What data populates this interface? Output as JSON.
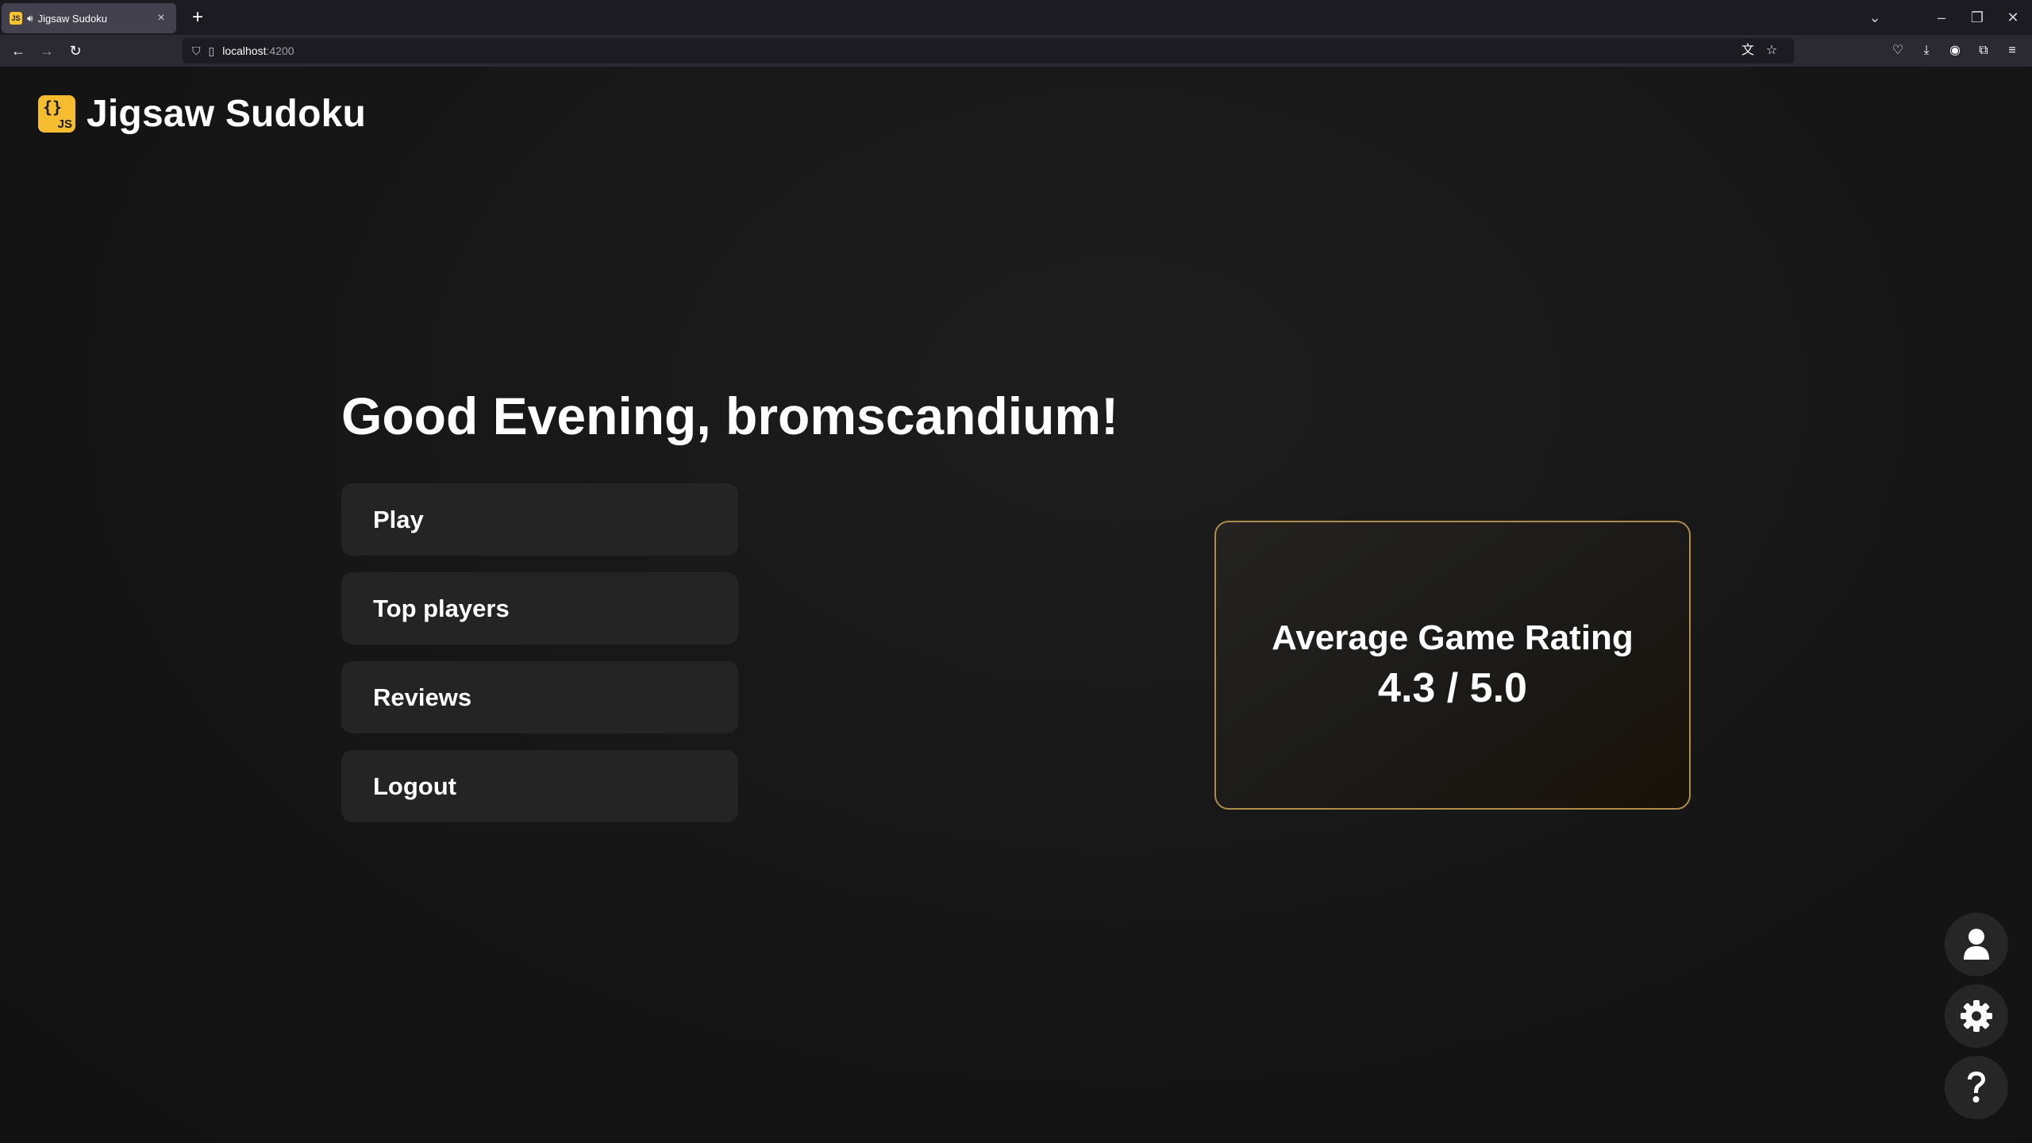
{
  "browser": {
    "tab_title": "Jigsaw Sudoku",
    "tab_favicon_text": "JS",
    "url_host": "localhost",
    "url_port": ":4200"
  },
  "header": {
    "logo_braces": "{}",
    "logo_js": "JS",
    "app_title": "Jigsaw Sudoku"
  },
  "main": {
    "greeting": "Good Evening, bromscandium!",
    "menu": [
      {
        "label": "Play"
      },
      {
        "label": "Top players"
      },
      {
        "label": "Reviews"
      },
      {
        "label": "Logout"
      }
    ],
    "rating": {
      "title": "Average Game Rating",
      "value": "4.3 / 5.0"
    }
  },
  "fabs": [
    {
      "icon": "user-icon"
    },
    {
      "icon": "gear-icon"
    },
    {
      "icon": "help-icon"
    }
  ],
  "colors": {
    "accent": "#f5bd2f",
    "card_border": "#b08c4a",
    "page_bg": "#141414",
    "button_bg": "#242424"
  }
}
